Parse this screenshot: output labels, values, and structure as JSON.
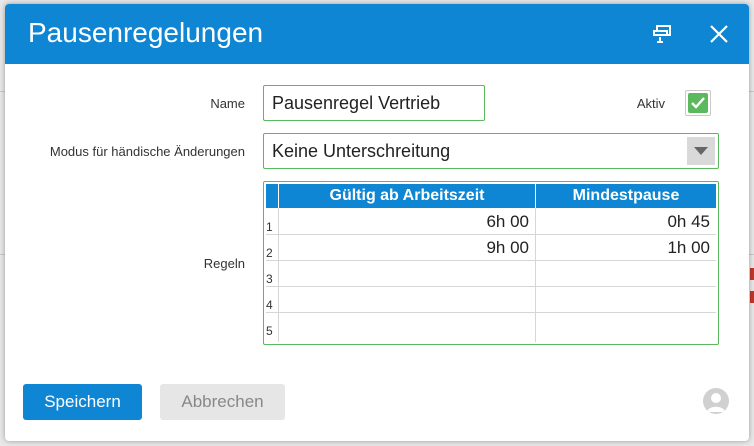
{
  "dialog": {
    "title": "Pausenregelungen",
    "header_icons": [
      "restore-window-icon",
      "close-icon"
    ]
  },
  "form": {
    "name_label": "Name",
    "name_value": "Pausenregel Vertrieb",
    "active_label": "Aktiv",
    "active_checked": true,
    "mode_label": "Modus für händische Änderungen",
    "mode_value": "Keine Unterschreitung",
    "rules_label": "Regeln"
  },
  "rules_table": {
    "columns": [
      "Gültig ab Arbeitszeit",
      "Mindestpause"
    ],
    "rows": [
      {
        "num": "1",
        "from": "6h 00",
        "min": "0h 45"
      },
      {
        "num": "2",
        "from": "9h 00",
        "min": "1h 00"
      },
      {
        "num": "3",
        "from": "",
        "min": ""
      },
      {
        "num": "4",
        "from": "",
        "min": ""
      },
      {
        "num": "5",
        "from": "",
        "min": ""
      }
    ]
  },
  "footer": {
    "save_label": "Speichern",
    "cancel_label": "Abbrechen",
    "user_icon": "user-avatar-icon"
  },
  "colors": {
    "accent": "#0e86d4",
    "valid_border": "#5cb85c",
    "checkbox_fill": "#5cb85c"
  }
}
